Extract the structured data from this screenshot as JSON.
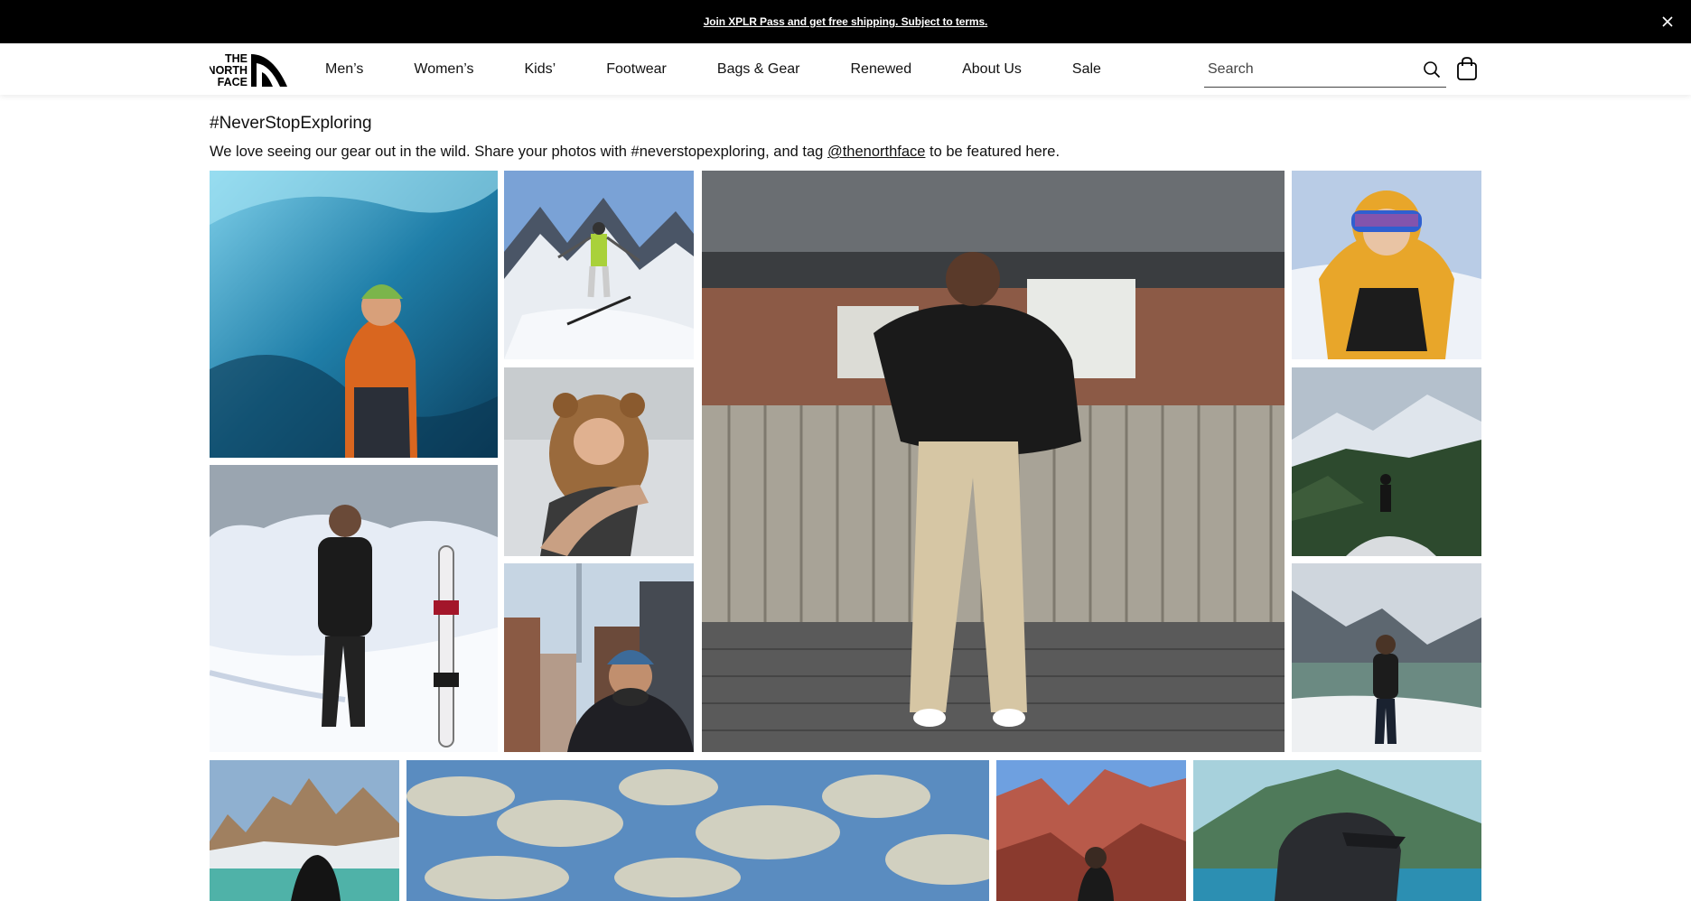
{
  "promo": {
    "text": "Join XPLR Pass and get free shipping. Subject to terms."
  },
  "header": {
    "logo_text": [
      "THE",
      "NORTH",
      "FACE"
    ],
    "nav": [
      "Men’s",
      "Women’s",
      "Kids’",
      "Footwear",
      "Bags & Gear",
      "Renewed",
      "About Us",
      "Sale"
    ],
    "search_placeholder": "Search"
  },
  "content": {
    "hashtag": "#NeverStopExploring",
    "desc_before": "We love seeing our gear out in the wild. Share your photos with #neverstopexploring, and tag ",
    "desc_link": "@thenorthface",
    "desc_after": " to be featured here."
  },
  "gallery": {
    "photos": [
      "ice-cave-explorer",
      "skier-mountain-peak",
      "baby-in-bear-suit",
      "snowboarder-woman",
      "city-street-selfie",
      "woman-puffer-jacket-fence",
      "child-yellow-jacket-goggles",
      "hiker-snowy-forest-overlook",
      "hiker-mountain-lake",
      "torres-del-paine-towers",
      "cloudy-sky",
      "red-rocks-hiker",
      "cap-lake-portrait"
    ]
  },
  "colors": {
    "promo_bg": "#000000",
    "text": "#111111"
  }
}
